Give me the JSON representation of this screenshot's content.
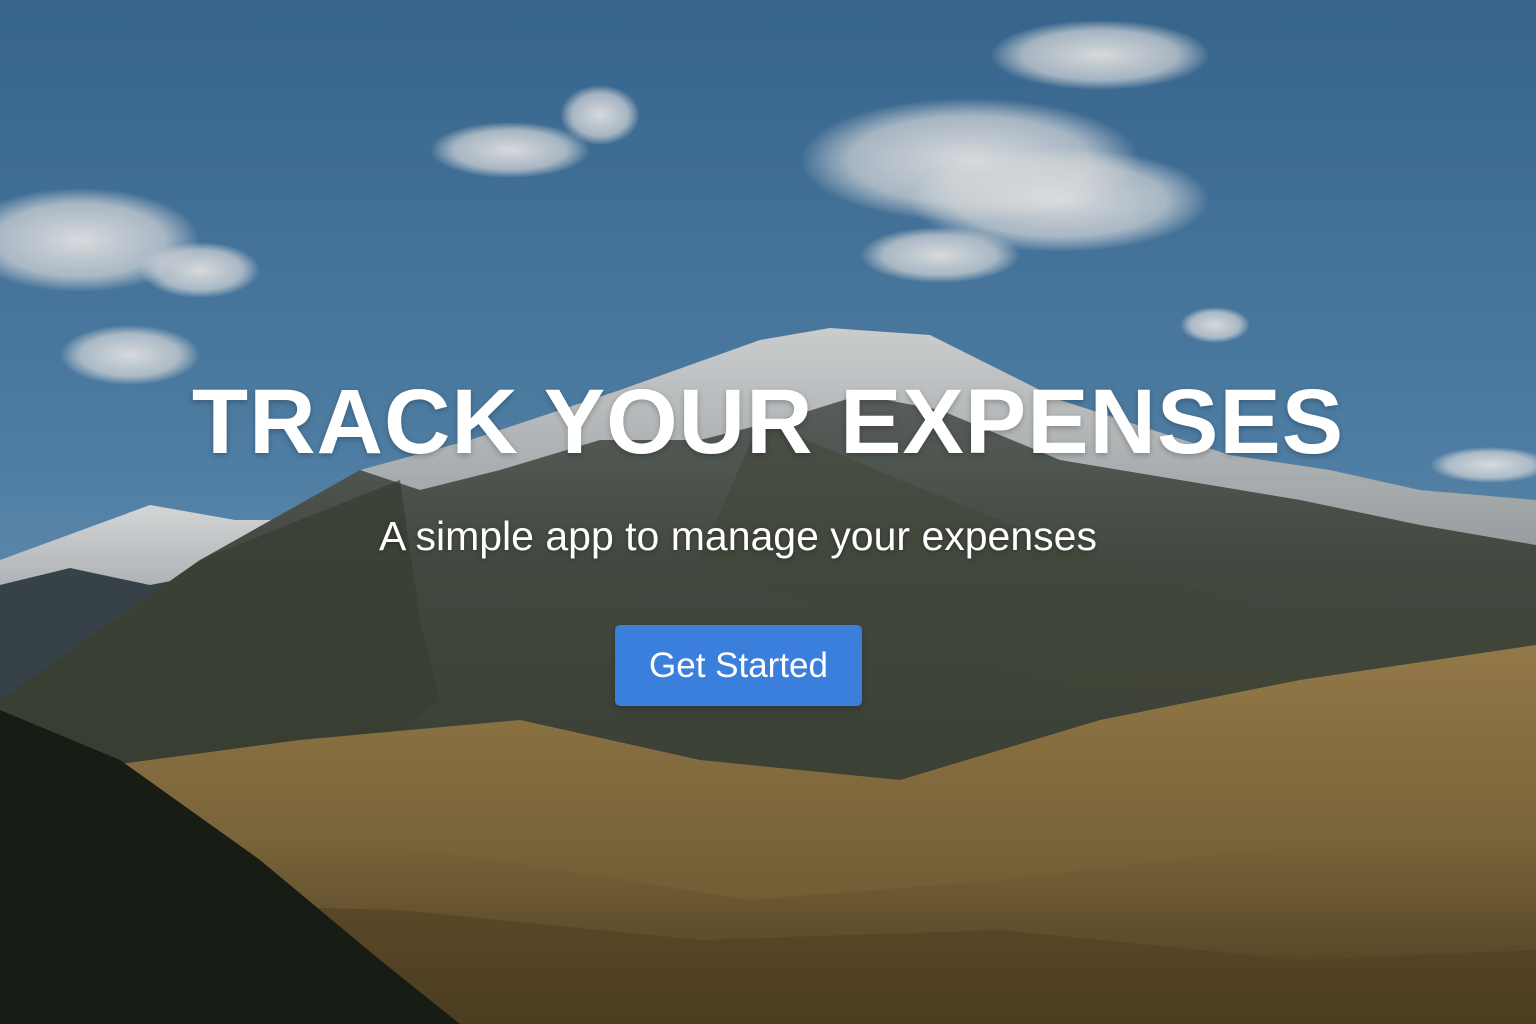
{
  "hero": {
    "title": "TRACK YOUR EXPENSES",
    "subtitle": "A simple app to manage your expenses",
    "cta_label": "Get Started",
    "background": "mountain-landscape-photo"
  },
  "colors": {
    "sky": "#4f86b3",
    "button": "#3a7fdc",
    "text": "#ffffff",
    "snow": "#e8ecef",
    "hills": "#8c7442"
  }
}
